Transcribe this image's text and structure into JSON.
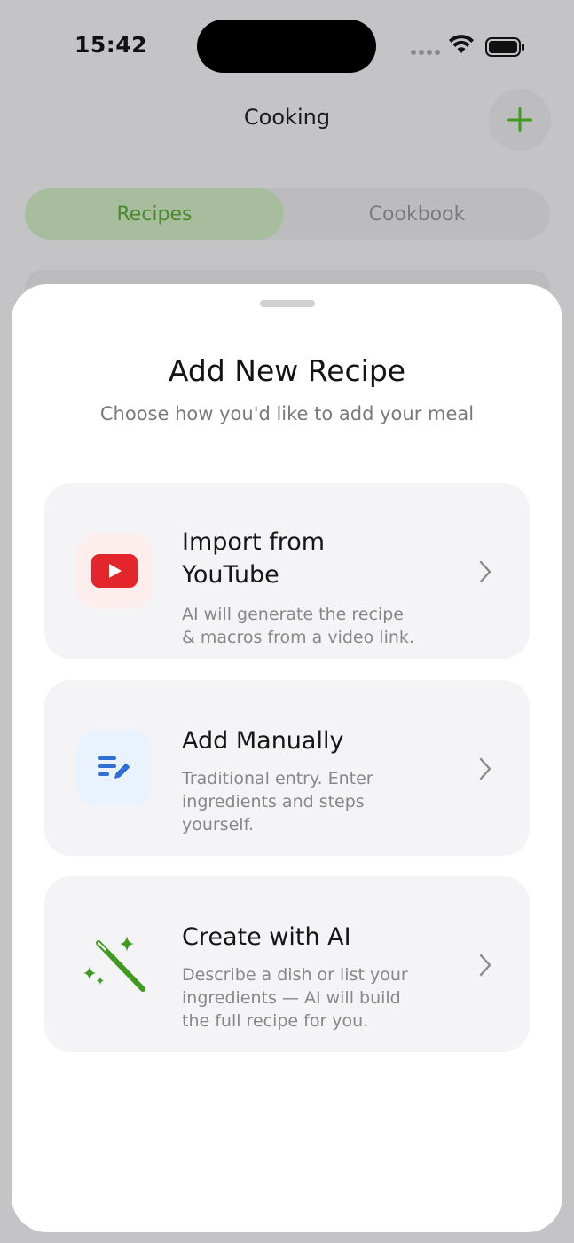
{
  "status": {
    "time": "15:42"
  },
  "nav": {
    "title": "Cooking",
    "add_icon": "plus-icon"
  },
  "tabs": [
    {
      "label": "Recipes",
      "selected": true
    },
    {
      "label": "Cookbook",
      "selected": false
    }
  ],
  "sheet": {
    "title": "Add New Recipe",
    "subtitle": "Choose how you'd like to add your meal",
    "options": [
      {
        "title_line1": "Import from",
        "title_line2": "YouTube",
        "desc_line1": "AI will generate the recipe",
        "desc_line2": "& macros from a video link.",
        "icon": "youtube-icon"
      },
      {
        "title_line1": "Add Manually",
        "desc_line1": "Traditional entry. Enter",
        "desc_line2": "ingredients and steps",
        "desc_line3": "yourself.",
        "icon": "edit-list-icon"
      },
      {
        "title_line1": "Create with AI",
        "desc_line1": "Describe a dish or list your",
        "desc_line2": "ingredients — AI will build",
        "desc_line3": "the full recipe for you.",
        "icon": "magic-wand-icon"
      }
    ]
  },
  "colors": {
    "accent_green": "#3f9b1f",
    "youtube_red": "#e3262c",
    "manual_blue": "#2f6fd6"
  }
}
